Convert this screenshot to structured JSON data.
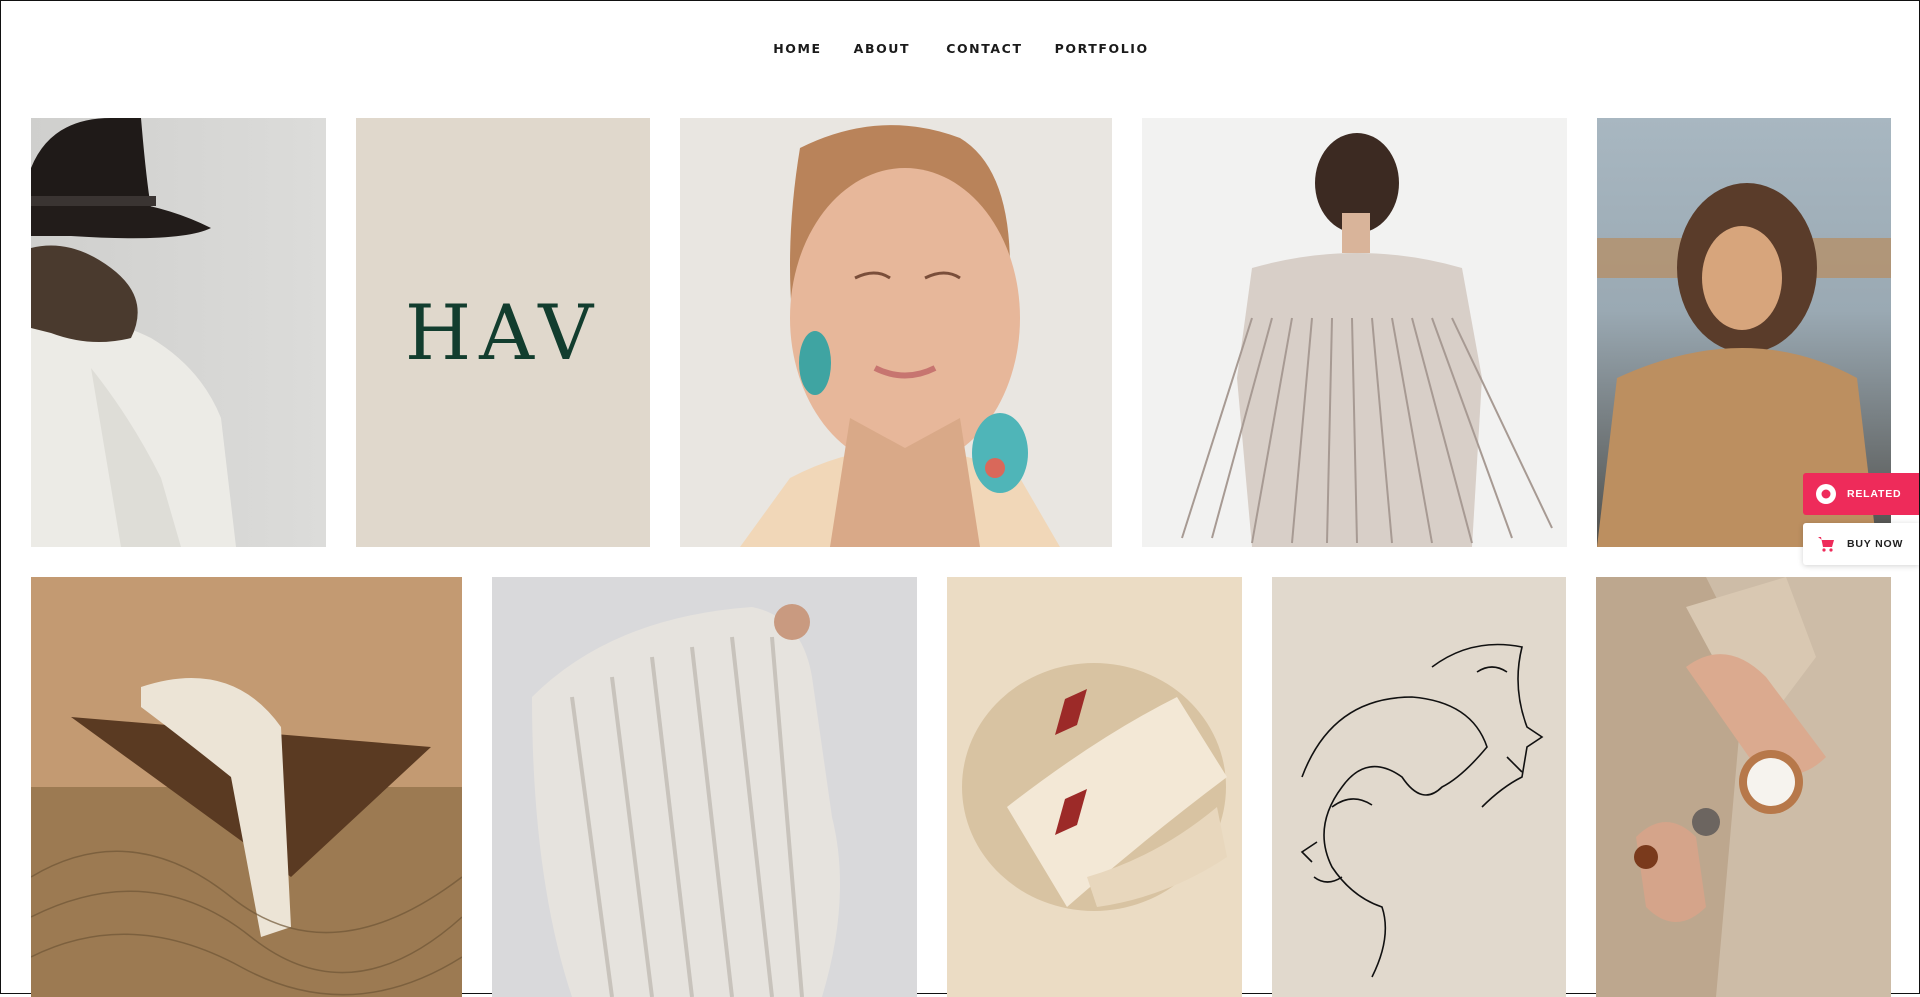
{
  "nav": {
    "home": "HOME",
    "about": "ABOUT",
    "contact": "CONTACT",
    "portfolio": "PORTFOLIO"
  },
  "logo": {
    "text": "HAV"
  },
  "side": {
    "related": "RELATED",
    "buy_now": "BUY NOW",
    "accent": "#ee2b5a"
  },
  "icons": [
    "related-icon",
    "cart-icon"
  ]
}
